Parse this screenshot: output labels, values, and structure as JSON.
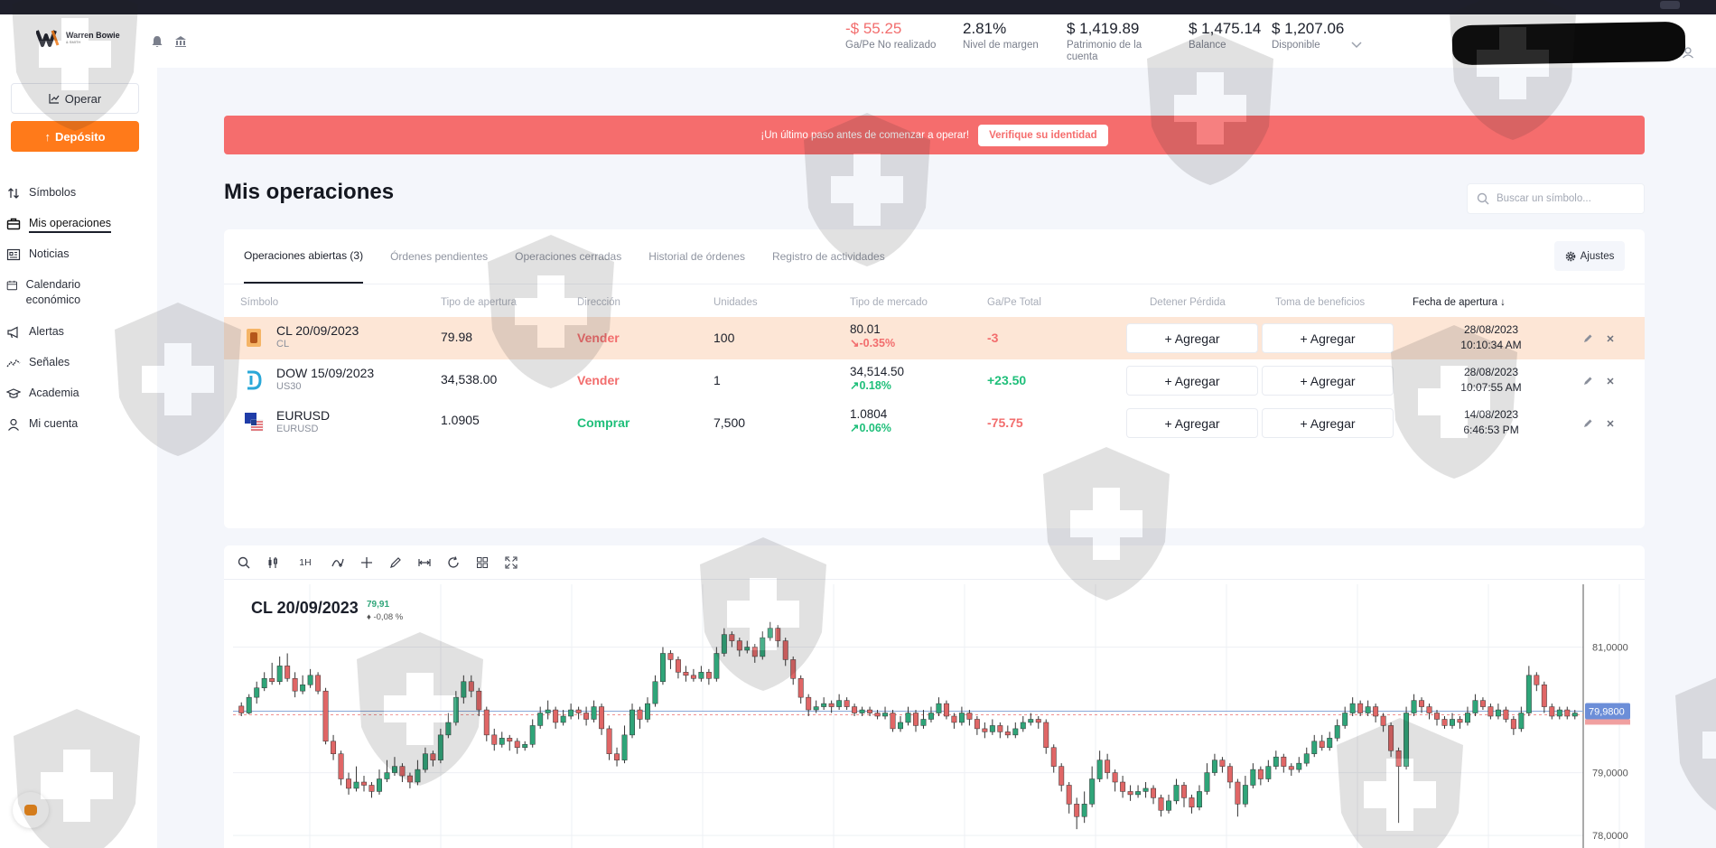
{
  "header": {
    "logo_name": "Warren Bowie",
    "logo_subtitle": "& SMITH",
    "metrics": [
      {
        "value": "-$ 55.25",
        "label": "Ga/Pe No realizado",
        "negative": true
      },
      {
        "value": "2.81%",
        "label": "Nivel de margen",
        "negative": false
      },
      {
        "value": "$ 1,419.89",
        "label": "Patrimonio de la cuenta",
        "negative": false
      },
      {
        "value": "$ 1,475.14",
        "label": "Balance",
        "negative": false
      },
      {
        "value": "$ 1,207.06",
        "label": "Disponible",
        "negative": false
      }
    ]
  },
  "sidebar": {
    "operar_label": "Operar",
    "deposito_label": "Depósito",
    "items": [
      {
        "label": "Símbolos",
        "icon": "arrows-updown-icon"
      },
      {
        "label": "Mis operaciones",
        "icon": "briefcase-icon",
        "active": true
      },
      {
        "label": "Noticias",
        "icon": "newspaper-icon"
      },
      {
        "label": "Calendario económico",
        "icon": "calendar-icon"
      },
      {
        "label": "Alertas",
        "icon": "megaphone-icon"
      },
      {
        "label": "Señales",
        "icon": "signal-icon"
      },
      {
        "label": "Academia",
        "icon": "graduation-cap-icon"
      },
      {
        "label": "Mi cuenta",
        "icon": "user-icon"
      }
    ]
  },
  "banner": {
    "text": "¡Un último paso antes de comenzar a operar!",
    "button_label": "Verifique su identidad"
  },
  "page_title": "Mis operaciones",
  "search": {
    "placeholder": "Buscar un símbolo..."
  },
  "tabs": [
    {
      "label": "Operaciones abiertas (3)",
      "active": true
    },
    {
      "label": "Órdenes pendientes"
    },
    {
      "label": "Operaciones cerradas"
    },
    {
      "label": "Historial de órdenes"
    },
    {
      "label": "Registro de actividades"
    }
  ],
  "ajustes_label": "Ajustes",
  "columns": [
    "Símbolo",
    "Tipo de apertura",
    "Dirección",
    "Unidades",
    "Tipo de mercado",
    "Ga/Pe Total",
    "Detener Pérdida",
    "Toma de beneficios",
    "Fecha de apertura ↓"
  ],
  "rows": [
    {
      "symbol": "CL 20/09/2023",
      "sub": "CL",
      "open": "79.98",
      "direction": "Vender",
      "dir_color": "red",
      "units": "100",
      "market": "80.01",
      "change": "↘-0.35%",
      "change_color": "red",
      "pl": "-3",
      "pl_color": "red",
      "sl": "+ Agregar",
      "tp": "+ Agregar",
      "date": "28/08/2023",
      "time": "10:10:34 AM",
      "icon": "oil-barrel-icon",
      "highlight": true
    },
    {
      "symbol": "DOW 15/09/2023",
      "sub": "US30",
      "open": "34,538.00",
      "direction": "Vender",
      "dir_color": "red",
      "units": "1",
      "market": "34,514.50",
      "change": "↗0.18%",
      "change_color": "green",
      "pl": "+23.50",
      "pl_color": "green",
      "sl": "+ Agregar",
      "tp": "+ Agregar",
      "date": "28/08/2023",
      "time": "10:07:55 AM",
      "icon": "dow-logo-icon",
      "highlight": false
    },
    {
      "symbol": "EURUSD",
      "sub": "EURUSD",
      "open": "1.0905",
      "direction": "Comprar",
      "dir_color": "green",
      "units": "7,500",
      "market": "1.0804",
      "change": "↗0.06%",
      "change_color": "green",
      "pl": "-75.75",
      "pl_color": "red",
      "sl": "+ Agregar",
      "tp": "+ Agregar",
      "date": "14/08/2023",
      "time": "6:46:53 PM",
      "icon": "eu-us-flag-icon",
      "highlight": false
    }
  ],
  "chart_toolbar": {
    "interval": "1H"
  },
  "chart_data": {
    "type": "candlestick",
    "title": "CL 20/09/2023",
    "last_price_label": "79,91",
    "change_label": "-0,08 %",
    "current_price_tag": "79,9800",
    "current_price": 79.98,
    "y_ticks": [
      "81,0000",
      "79,0000",
      "78,0000"
    ],
    "y_tick_values": [
      81.0,
      79.0,
      78.0
    ],
    "ylim": [
      77.8,
      82.0
    ],
    "candles": [
      [
        80.06,
        79.95,
        80.12,
        79.9
      ],
      [
        79.95,
        80.2,
        80.25,
        79.93
      ],
      [
        80.2,
        80.35,
        80.45,
        80.1
      ],
      [
        80.35,
        80.5,
        80.6,
        80.3
      ],
      [
        80.5,
        80.45,
        80.75,
        80.4
      ],
      [
        80.45,
        80.7,
        80.85,
        80.4
      ],
      [
        80.7,
        80.5,
        80.9,
        80.45
      ],
      [
        80.5,
        80.3,
        80.6,
        80.2
      ],
      [
        80.3,
        80.4,
        80.55,
        80.25
      ],
      [
        80.4,
        80.55,
        80.65,
        80.35
      ],
      [
        80.55,
        80.3,
        80.6,
        80.25
      ],
      [
        80.3,
        79.5,
        80.35,
        79.45
      ],
      [
        79.5,
        79.3,
        79.6,
        79.2
      ],
      [
        79.3,
        78.9,
        79.35,
        78.8
      ],
      [
        78.9,
        78.75,
        79.0,
        78.65
      ],
      [
        78.75,
        78.85,
        79.1,
        78.7
      ],
      [
        78.85,
        78.8,
        78.95,
        78.7
      ],
      [
        78.8,
        78.7,
        78.85,
        78.6
      ],
      [
        78.7,
        78.9,
        79.05,
        78.65
      ],
      [
        78.9,
        79.0,
        79.2,
        78.85
      ],
      [
        79.0,
        79.1,
        79.25,
        78.95
      ],
      [
        79.1,
        78.95,
        79.15,
        78.85
      ],
      [
        78.95,
        78.85,
        79.0,
        78.75
      ],
      [
        78.85,
        79.05,
        79.2,
        78.8
      ],
      [
        79.05,
        79.3,
        79.4,
        79.0
      ],
      [
        79.3,
        79.2,
        79.35,
        79.1
      ],
      [
        79.2,
        79.6,
        79.7,
        79.15
      ],
      [
        79.6,
        79.8,
        79.95,
        79.55
      ],
      [
        79.8,
        80.2,
        80.3,
        79.75
      ],
      [
        80.2,
        80.45,
        80.55,
        80.1
      ],
      [
        80.45,
        80.3,
        80.55,
        80.2
      ],
      [
        80.3,
        80.0,
        80.35,
        79.9
      ],
      [
        80.0,
        79.6,
        80.05,
        79.5
      ],
      [
        79.6,
        79.45,
        79.7,
        79.35
      ],
      [
        79.45,
        79.55,
        79.65,
        79.4
      ],
      [
        79.55,
        79.5,
        79.6,
        79.35
      ],
      [
        79.5,
        79.4,
        79.55,
        79.3
      ],
      [
        79.4,
        79.45,
        79.5,
        79.35
      ],
      [
        79.45,
        79.75,
        79.85,
        79.4
      ],
      [
        79.75,
        79.95,
        80.05,
        79.7
      ],
      [
        79.95,
        80.0,
        80.15,
        79.85
      ],
      [
        80.0,
        79.8,
        80.05,
        79.7
      ],
      [
        79.8,
        79.9,
        80.0,
        79.75
      ],
      [
        79.9,
        80.0,
        80.1,
        79.85
      ],
      [
        80.0,
        79.95,
        80.05,
        79.85
      ],
      [
        79.95,
        79.85,
        80.05,
        79.75
      ],
      [
        79.85,
        80.05,
        80.15,
        79.8
      ],
      [
        80.05,
        79.7,
        80.1,
        79.6
      ],
      [
        79.7,
        79.3,
        79.75,
        79.2
      ],
      [
        79.3,
        79.2,
        79.4,
        79.1
      ],
      [
        79.2,
        79.6,
        79.75,
        79.15
      ],
      [
        79.6,
        80.0,
        80.1,
        79.55
      ],
      [
        80.0,
        79.85,
        80.05,
        79.7
      ],
      [
        79.85,
        80.1,
        80.2,
        79.8
      ],
      [
        80.1,
        80.45,
        80.55,
        80.05
      ],
      [
        80.45,
        80.9,
        81.0,
        80.4
      ],
      [
        80.9,
        80.8,
        80.95,
        80.65
      ],
      [
        80.8,
        80.6,
        80.85,
        80.5
      ],
      [
        80.6,
        80.55,
        80.7,
        80.45
      ],
      [
        80.55,
        80.5,
        80.65,
        80.45
      ],
      [
        80.5,
        80.6,
        80.7,
        80.45
      ],
      [
        80.6,
        80.5,
        80.65,
        80.4
      ],
      [
        80.5,
        80.9,
        81.0,
        80.45
      ],
      [
        80.9,
        81.2,
        81.3,
        80.85
      ],
      [
        81.2,
        81.1,
        81.25,
        81.0
      ],
      [
        81.1,
        80.95,
        81.15,
        80.85
      ],
      [
        80.95,
        81.0,
        81.1,
        80.9
      ],
      [
        81.0,
        80.85,
        81.05,
        80.75
      ],
      [
        80.85,
        81.15,
        81.25,
        80.8
      ],
      [
        81.15,
        81.3,
        81.4,
        81.1
      ],
      [
        81.3,
        81.1,
        81.35,
        81.0
      ],
      [
        81.1,
        80.8,
        81.15,
        80.7
      ],
      [
        80.8,
        80.5,
        80.85,
        80.4
      ],
      [
        80.5,
        80.2,
        80.55,
        80.1
      ],
      [
        80.2,
        80.0,
        80.25,
        79.9
      ],
      [
        80.0,
        80.05,
        80.15,
        79.95
      ],
      [
        80.05,
        80.1,
        80.2,
        80.0
      ],
      [
        80.1,
        80.05,
        80.15,
        79.95
      ],
      [
        80.05,
        80.15,
        80.25,
        80.0
      ],
      [
        80.15,
        80.05,
        80.2,
        80.0
      ],
      [
        80.05,
        79.95,
        80.1,
        79.9
      ],
      [
        79.95,
        80.0,
        80.05,
        79.9
      ],
      [
        80.0,
        79.95,
        80.05,
        79.9
      ],
      [
        79.95,
        79.9,
        80.0,
        79.85
      ],
      [
        79.9,
        79.95,
        80.05,
        79.85
      ],
      [
        79.95,
        79.7,
        80.0,
        79.65
      ],
      [
        79.7,
        79.8,
        79.9,
        79.65
      ],
      [
        79.8,
        79.95,
        80.05,
        79.75
      ],
      [
        79.95,
        79.75,
        80.0,
        79.65
      ],
      [
        79.75,
        79.85,
        80.0,
        79.7
      ],
      [
        79.85,
        79.95,
        80.05,
        79.8
      ],
      [
        79.95,
        80.1,
        80.2,
        79.9
      ],
      [
        80.1,
        79.9,
        80.15,
        79.85
      ],
      [
        79.9,
        79.8,
        79.95,
        79.7
      ],
      [
        79.8,
        79.95,
        80.05,
        79.75
      ],
      [
        79.95,
        79.85,
        80.0,
        79.75
      ],
      [
        79.85,
        79.7,
        79.9,
        79.6
      ],
      [
        79.7,
        79.65,
        79.8,
        79.55
      ],
      [
        79.65,
        79.75,
        79.85,
        79.6
      ],
      [
        79.75,
        79.65,
        79.8,
        79.55
      ],
      [
        79.65,
        79.6,
        79.75,
        79.55
      ],
      [
        79.6,
        79.7,
        79.8,
        79.55
      ],
      [
        79.7,
        79.8,
        79.9,
        79.65
      ],
      [
        79.8,
        79.85,
        79.95,
        79.75
      ],
      [
        79.85,
        79.8,
        79.9,
        79.7
      ],
      [
        79.8,
        79.4,
        79.85,
        79.3
      ],
      [
        79.4,
        79.1,
        79.45,
        79.0
      ],
      [
        79.1,
        78.8,
        79.15,
        78.7
      ],
      [
        78.8,
        78.5,
        78.85,
        78.35
      ],
      [
        78.5,
        78.3,
        78.6,
        78.1
      ],
      [
        78.3,
        78.5,
        78.7,
        78.2
      ],
      [
        78.5,
        78.9,
        79.1,
        78.45
      ],
      [
        78.9,
        79.2,
        79.35,
        78.85
      ],
      [
        79.2,
        79.0,
        79.3,
        78.9
      ],
      [
        79.0,
        78.85,
        79.05,
        78.7
      ],
      [
        78.85,
        78.7,
        78.95,
        78.6
      ],
      [
        78.7,
        78.65,
        78.8,
        78.55
      ],
      [
        78.65,
        78.7,
        78.8,
        78.6
      ],
      [
        78.7,
        78.75,
        78.85,
        78.6
      ],
      [
        78.75,
        78.6,
        78.8,
        78.5
      ],
      [
        78.6,
        78.4,
        78.65,
        78.3
      ],
      [
        78.4,
        78.55,
        78.65,
        78.35
      ],
      [
        78.55,
        78.8,
        78.9,
        78.5
      ],
      [
        78.8,
        78.6,
        78.85,
        78.45
      ],
      [
        78.6,
        78.45,
        78.65,
        78.35
      ],
      [
        78.45,
        78.7,
        78.8,
        78.4
      ],
      [
        78.7,
        79.0,
        79.15,
        78.65
      ],
      [
        79.0,
        79.2,
        79.3,
        78.95
      ],
      [
        79.2,
        79.1,
        79.25,
        79.0
      ],
      [
        79.1,
        78.85,
        79.15,
        78.75
      ],
      [
        78.85,
        78.5,
        78.9,
        78.3
      ],
      [
        78.5,
        78.8,
        78.95,
        78.45
      ],
      [
        78.8,
        79.05,
        79.15,
        78.75
      ],
      [
        79.05,
        78.9,
        79.1,
        78.8
      ],
      [
        78.9,
        79.1,
        79.2,
        78.85
      ],
      [
        79.1,
        79.25,
        79.35,
        79.05
      ],
      [
        79.25,
        79.1,
        79.3,
        79.0
      ],
      [
        79.1,
        79.05,
        79.15,
        78.95
      ],
      [
        79.05,
        79.15,
        79.25,
        79.0
      ],
      [
        79.15,
        79.3,
        79.4,
        79.1
      ],
      [
        79.3,
        79.5,
        79.6,
        79.25
      ],
      [
        79.5,
        79.4,
        79.6,
        79.35
      ],
      [
        79.4,
        79.55,
        79.65,
        79.35
      ],
      [
        79.55,
        79.75,
        79.85,
        79.5
      ],
      [
        79.75,
        79.95,
        80.05,
        79.7
      ],
      [
        79.95,
        80.1,
        80.2,
        79.9
      ],
      [
        80.1,
        79.95,
        80.15,
        79.9
      ],
      [
        79.95,
        80.05,
        80.15,
        79.9
      ],
      [
        80.05,
        79.9,
        80.1,
        79.8
      ],
      [
        79.9,
        79.75,
        79.95,
        79.65
      ],
      [
        79.75,
        79.35,
        79.8,
        79.25
      ],
      [
        79.35,
        79.1,
        79.4,
        78.2
      ],
      [
        79.1,
        79.95,
        80.05,
        79.05
      ],
      [
        79.95,
        80.15,
        80.25,
        79.9
      ],
      [
        80.15,
        80.05,
        80.2,
        79.95
      ],
      [
        80.05,
        79.95,
        80.1,
        79.85
      ],
      [
        79.95,
        79.85,
        80.0,
        79.75
      ],
      [
        79.85,
        79.75,
        79.9,
        79.7
      ],
      [
        79.75,
        79.85,
        79.95,
        79.7
      ],
      [
        79.85,
        79.8,
        79.9,
        79.7
      ],
      [
        79.8,
        79.95,
        80.05,
        79.75
      ],
      [
        79.95,
        80.15,
        80.25,
        79.9
      ],
      [
        80.15,
        80.05,
        80.2,
        80.0
      ],
      [
        80.05,
        79.9,
        80.1,
        79.85
      ],
      [
        79.9,
        80.0,
        80.1,
        79.85
      ],
      [
        80.0,
        79.85,
        80.05,
        79.8
      ],
      [
        79.85,
        79.7,
        79.9,
        79.6
      ],
      [
        79.7,
        79.95,
        80.05,
        79.65
      ],
      [
        79.95,
        80.55,
        80.7,
        79.9
      ],
      [
        80.55,
        80.4,
        80.6,
        80.3
      ],
      [
        80.4,
        80.05,
        80.45,
        79.95
      ],
      [
        80.05,
        79.9,
        80.1,
        79.85
      ],
      [
        79.9,
        80.0,
        80.05,
        79.85
      ],
      [
        80.0,
        79.9,
        80.05,
        79.85
      ],
      [
        79.9,
        79.95,
        80.0,
        79.85
      ]
    ]
  }
}
